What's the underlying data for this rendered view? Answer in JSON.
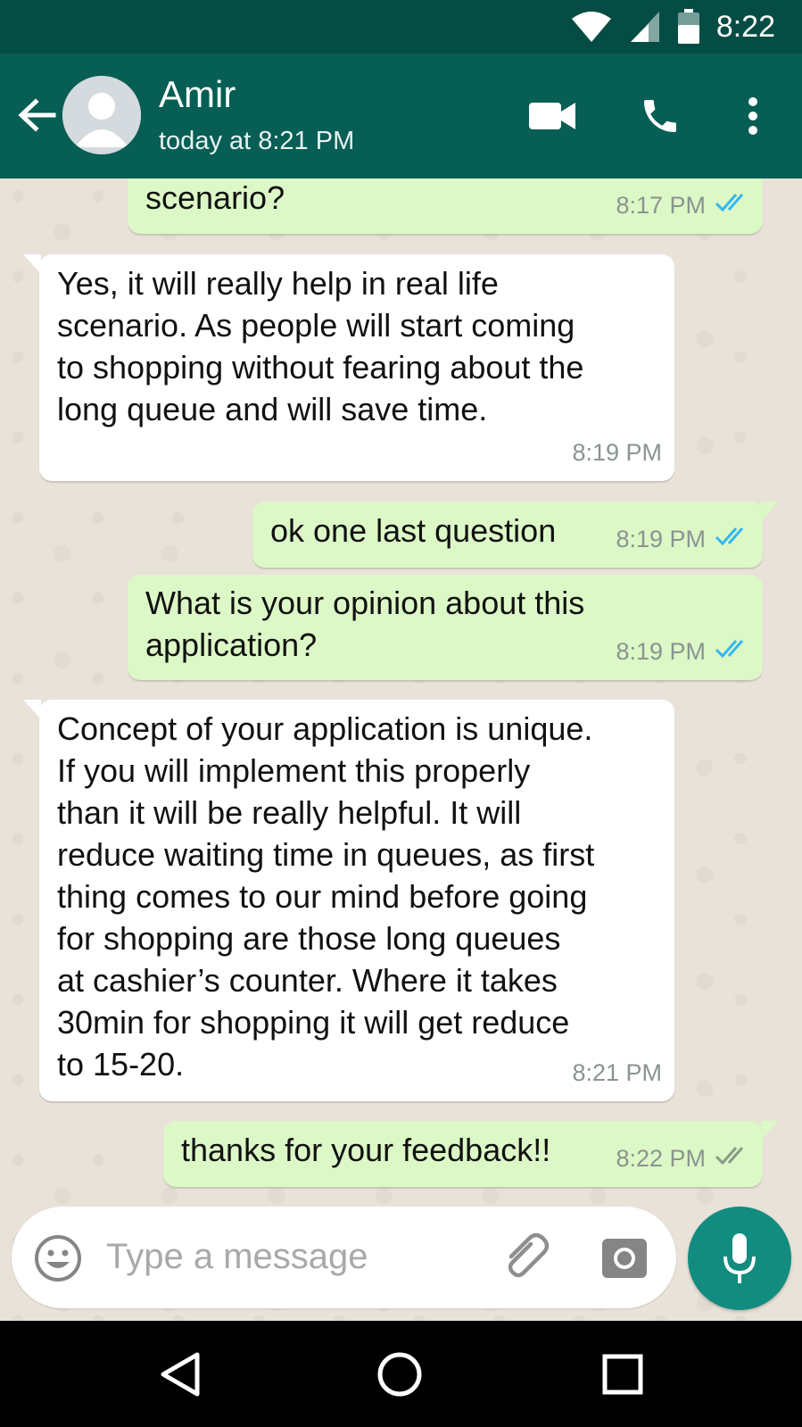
{
  "status_bar": {
    "time": "8:22",
    "icons": [
      "wifi-icon",
      "signal-icon",
      "battery-icon"
    ]
  },
  "header": {
    "contact_name": "Amir",
    "contact_status": "today at 8:21 PM",
    "actions": [
      "video-call-icon",
      "phone-icon",
      "more-vert-icon"
    ]
  },
  "messages": [
    {
      "direction": "out",
      "text": "scenario?",
      "time": "8:17 PM",
      "status": "read"
    },
    {
      "direction": "in",
      "text": "Yes, it will really help in real life\nscenario. As people will start coming\nto shopping without fearing about the\nlong queue and will save time.",
      "time": "8:19 PM"
    },
    {
      "direction": "out",
      "text": "ok one last question",
      "time": "8:19 PM",
      "status": "read"
    },
    {
      "direction": "out",
      "text": "What is your opinion about this\napplication?",
      "time": "8:19 PM",
      "status": "read"
    },
    {
      "direction": "in",
      "text": "Concept of your application is unique.\nIf you will implement this properly\nthan it will be really helpful. It will\nreduce waiting time in queues, as first\nthing comes to our mind before going\nfor shopping are those long queues\nat cashier’s counter. Where it takes\n30min for shopping it will get reduce\nto 15-20.",
      "time": "8:21 PM"
    },
    {
      "direction": "out",
      "text": "thanks for your feedback!!",
      "time": "8:22 PM",
      "status": "delivered"
    }
  ],
  "composer": {
    "placeholder": "Type a message",
    "value": ""
  },
  "colors": {
    "status_bar": "#054d44",
    "header": "#075e54",
    "outgoing_bubble": "#dcf8c6",
    "incoming_bubble": "#ffffff",
    "read_tick": "#34b7f1",
    "delivered_tick": "#92a58c",
    "mic_button": "#128c7e"
  }
}
